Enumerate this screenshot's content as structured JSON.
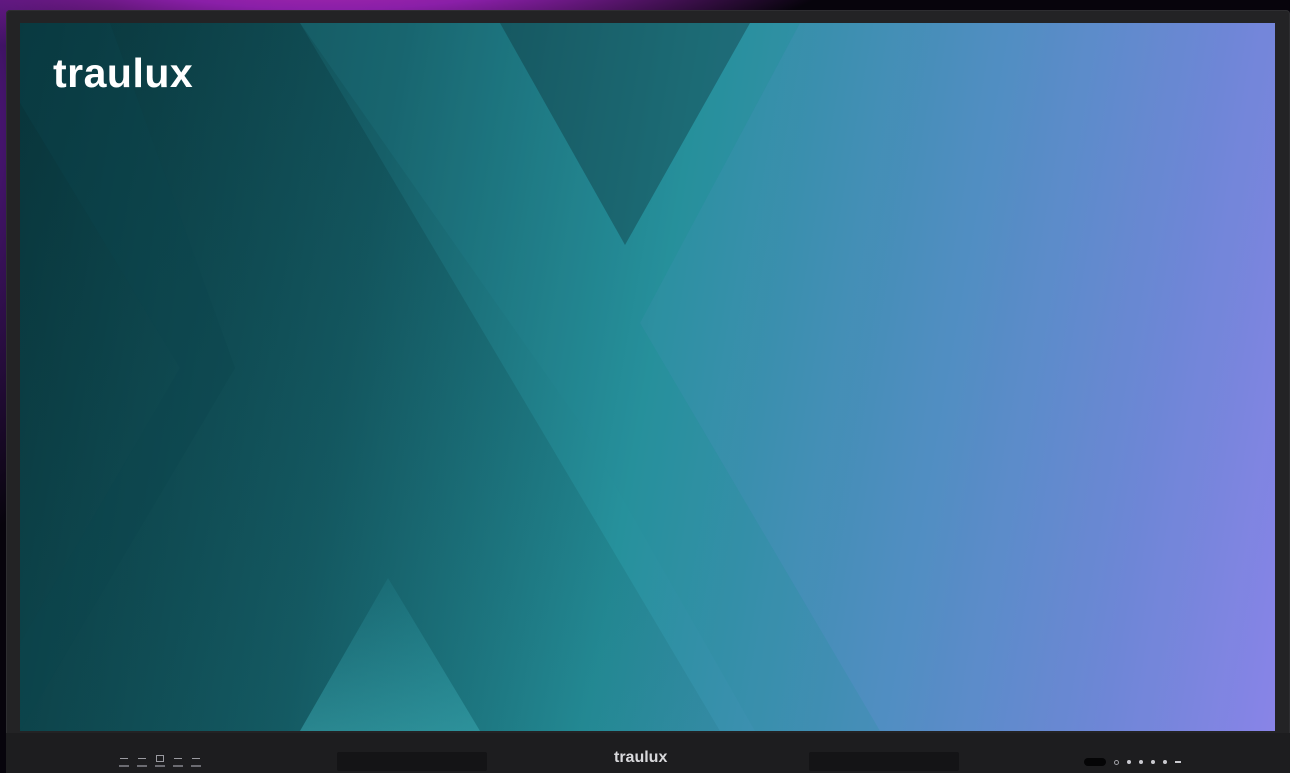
{
  "brand": {
    "screen_logo": "traulux",
    "bezel_logo": "traulux"
  },
  "colors": {
    "screen_dark": "#0a3a40",
    "screen_teal": "#26919c",
    "screen_violet": "#8a84e8",
    "bezel": "#232325",
    "desktop_magenta": "#c02fb0"
  },
  "bezel": {
    "left_buttons": [
      "input-button",
      "home-button",
      "screen-button",
      "menu-button",
      "back-button"
    ],
    "right_buttons": [
      "power-sensor",
      "light-sensor",
      "source-button",
      "settings-button",
      "volume-up-button",
      "volume-down-button",
      "volume-mute-button"
    ]
  }
}
